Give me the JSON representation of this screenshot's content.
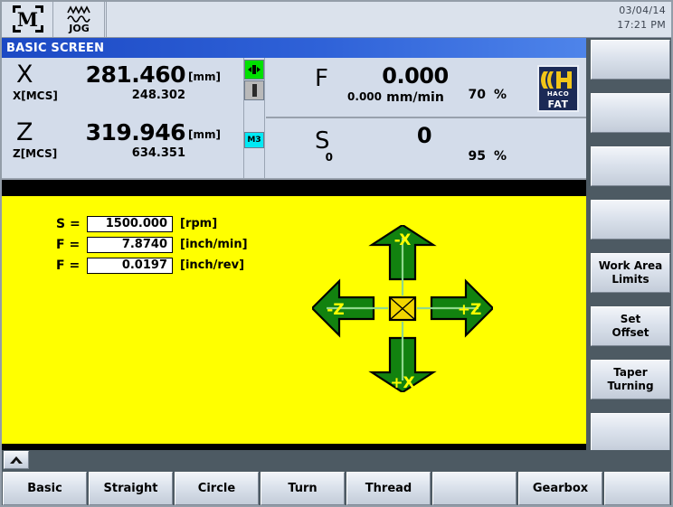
{
  "window": {
    "title": "BASIC SCREEN",
    "date": "03/04/14",
    "time": "17:21 PM"
  },
  "mode_bar": {
    "machine_icon": "machine-mode-icon",
    "machine_letter": "M",
    "jog_icon": "jog-wave-icon",
    "jog_label": "JOG"
  },
  "dro": {
    "axes": [
      {
        "name": "X",
        "value": "281.460",
        "unit": "[mm]",
        "mcs_label": "X[MCS]",
        "mcs_value": "248.302"
      },
      {
        "name": "Z",
        "value": "319.946",
        "unit": "[mm]",
        "mcs_label": "Z[MCS]",
        "mcs_value": "634.351"
      }
    ],
    "status_icons": [
      {
        "name": "chuck-clamped-icon",
        "color": "#00e000",
        "label": ""
      },
      {
        "name": "tailstock-icon",
        "color": "#b9b9b9",
        "label": ""
      },
      {
        "name": "spindle-direction-icon",
        "color": "#00eaf5",
        "label": "M3"
      }
    ],
    "feed": {
      "letter": "F",
      "actual": "0.000",
      "programmed": "0.000",
      "units": "mm/min",
      "override": "70",
      "percent_symbol": "%"
    },
    "spindle": {
      "letter": "S",
      "actual": "0",
      "programmed": "0",
      "units": "",
      "override": "95",
      "percent_symbol": "%"
    },
    "logo": {
      "brand": "HACO",
      "sub": "FAT",
      "mark": "haco-h-logo"
    }
  },
  "main": {
    "parameters": [
      {
        "label": "S =",
        "value": "1500.000",
        "unit": "[rpm]"
      },
      {
        "label": "F =",
        "value": "7.8740",
        "unit": "[inch/min]"
      },
      {
        "label": "F =",
        "value": "0.0197",
        "unit": "[inch/rev]"
      }
    ],
    "jog_cross": {
      "icon": "jog-axis-cross-icon",
      "up": "-X",
      "down": "+X",
      "left": "-Z",
      "right": "+Z",
      "arrow_fill": "#12820f",
      "arrow_stroke": "#000000",
      "label_color": "#ffff00",
      "background": "#ffff00"
    }
  },
  "right_softkeys": [
    {
      "lines": [
        ""
      ],
      "name": "softkey-1"
    },
    {
      "lines": [
        ""
      ],
      "name": "softkey-2"
    },
    {
      "lines": [
        ""
      ],
      "name": "softkey-3"
    },
    {
      "lines": [
        ""
      ],
      "name": "softkey-4"
    },
    {
      "lines": [
        "Work Area",
        "Limits"
      ],
      "name": "softkey-work-area-limits"
    },
    {
      "lines": [
        "Set",
        "Offset"
      ],
      "name": "softkey-set-offset"
    },
    {
      "lines": [
        "Taper",
        "Turning"
      ],
      "name": "softkey-taper-turning"
    },
    {
      "lines": [
        ""
      ],
      "name": "softkey-8"
    }
  ],
  "bottom": {
    "up_arrow": "▲",
    "keys": [
      {
        "label": "Basic"
      },
      {
        "label": "Straight"
      },
      {
        "label": "Circle"
      },
      {
        "label": "Turn"
      },
      {
        "label": "Thread"
      },
      {
        "label": ""
      },
      {
        "label": "Gearbox"
      },
      {
        "label": ""
      }
    ]
  },
  "colors": {
    "title_blue": "#1c49c4",
    "panel_bg": "#d3dcea",
    "main_yellow": "#ffff00",
    "frame_gray": "#4d5a63",
    "arrow_green": "#12820f"
  }
}
